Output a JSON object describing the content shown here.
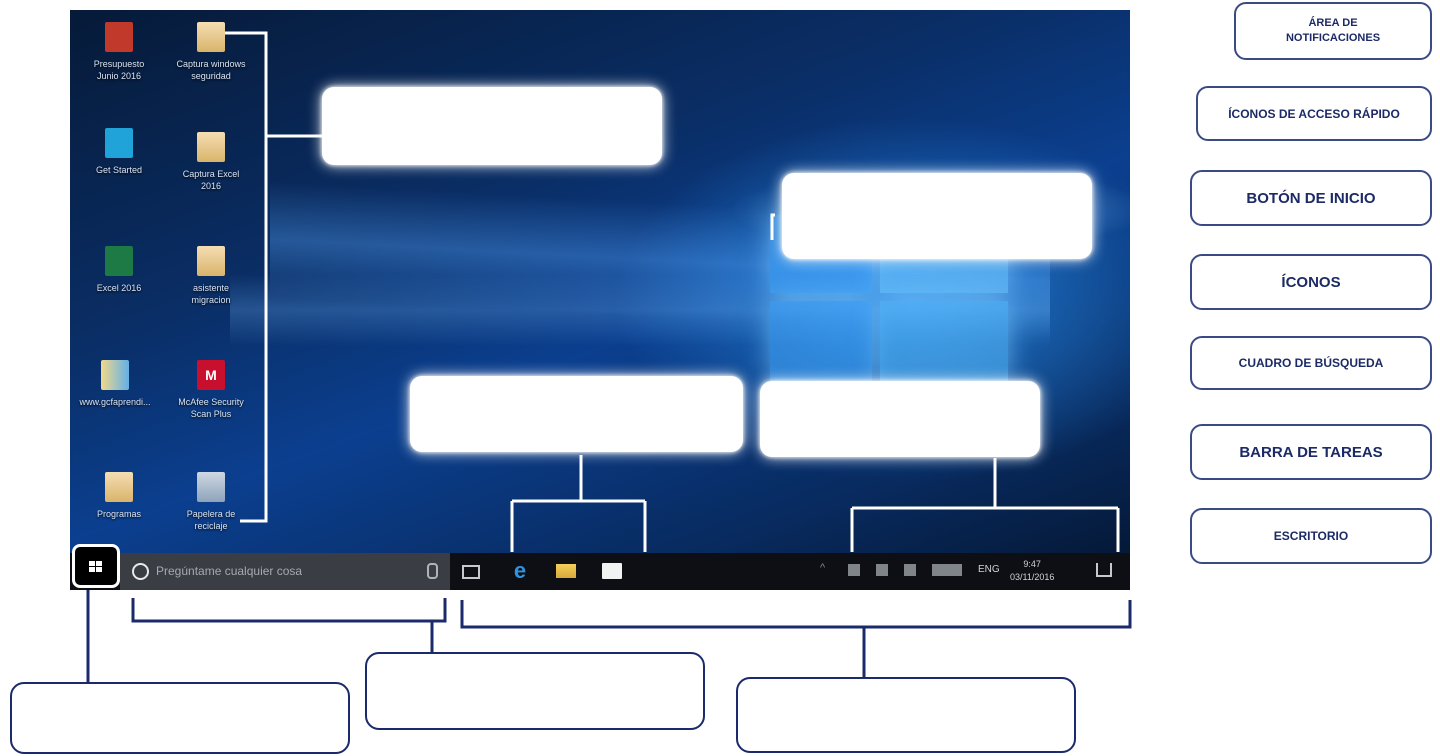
{
  "word_bank": [
    "ÁREA DE\nNOTIFICACIONES",
    "ÍCONOS DE ACCESO RÁPIDO",
    "BOTÓN DE INICIO",
    "ÍCONOS",
    "CUADRO DE BÚSQUEDA",
    "BARRA DE TAREAS",
    "ESCRITORIO"
  ],
  "desktop_icons": [
    {
      "label": "Presupuesto\nJunio 2016",
      "icon": "pdf-icon"
    },
    {
      "label": "Captura windows\nseguridad",
      "icon": "folder-icon"
    },
    {
      "label": "Get Started",
      "icon": "get-started-icon"
    },
    {
      "label": "Captura Excel\n2016",
      "icon": "folder-icon"
    },
    {
      "label": "Excel 2016",
      "icon": "excel-icon"
    },
    {
      "label": "asistente\nmigracion",
      "icon": "folder-icon"
    },
    {
      "label": "www.gcfaprendi...",
      "icon": "book-icon"
    },
    {
      "label": "McAfee Security\nScan Plus",
      "icon": "mcafee-icon"
    },
    {
      "label": "Programas",
      "icon": "folder-icon"
    },
    {
      "label": "Papelera de\nreciclaje",
      "icon": "recycle-bin-icon"
    }
  ],
  "taskbar": {
    "search_placeholder": "Pregúntame cualquier cosa",
    "language": "ENG",
    "time": "9:47",
    "date": "03/11/2016",
    "pinned_icons": [
      "task-view-icon",
      "edge-icon",
      "file-explorer-icon",
      "store-icon"
    ],
    "tray_icons": [
      "chevron-up-icon",
      "battery-icon",
      "network-icon",
      "volume-icon",
      "keyboard-icon"
    ]
  },
  "answer_boxes": [
    "",
    "",
    "",
    "",
    "",
    "",
    "",
    ""
  ],
  "colors": {
    "bank_text": "#1c2a66",
    "bank_border": "#3a4a85",
    "connector": "#1b2a6b",
    "taskbar": "#0d0f15"
  }
}
